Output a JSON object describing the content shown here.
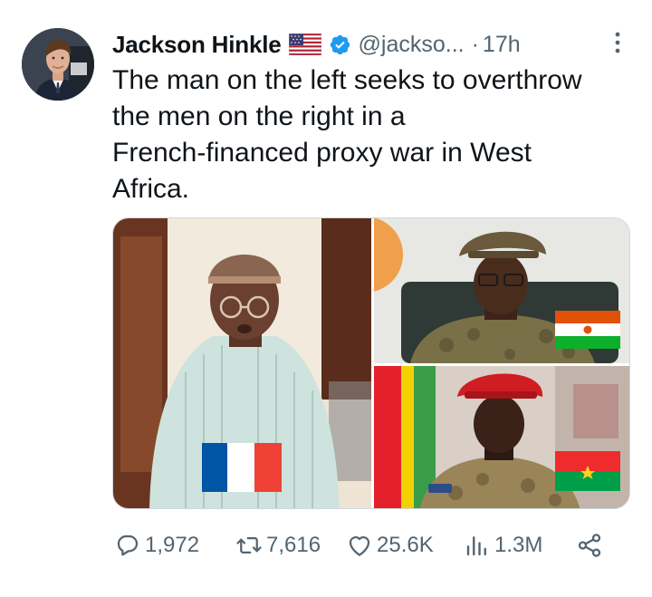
{
  "author": {
    "name": "Jackson Hinkle",
    "handle": "@jackso...",
    "separator": "·",
    "time": "17h",
    "flag_icon": "us-flag-icon",
    "verified_icon": "verified-badge-icon",
    "verified_color": "#1d9bf0"
  },
  "tweet": {
    "lines": [
      "The man on the left seeks to overthrow",
      "the men on the right in a",
      "French-financed proxy war in West",
      "Africa."
    ]
  },
  "media": [
    {
      "position": "left",
      "flag": "France",
      "flag_colors": [
        "#0055a4",
        "#ffffff",
        "#ef4135"
      ]
    },
    {
      "position": "top-right",
      "flag": "Niger",
      "flag_colors": [
        "#e05206",
        "#ffffff",
        "#0db02b"
      ]
    },
    {
      "position": "bottom-right",
      "flag": "Burkina Faso",
      "flag_colors": [
        "#ef2b2d",
        "#009e49",
        "#fcd116"
      ]
    }
  ],
  "actions": {
    "replies": "1,972",
    "retweets": "7,616",
    "likes": "25.6K",
    "views": "1.3M"
  },
  "colors": {
    "text": "#0f1419",
    "muted": "#536471",
    "border": "#cfd9de"
  }
}
